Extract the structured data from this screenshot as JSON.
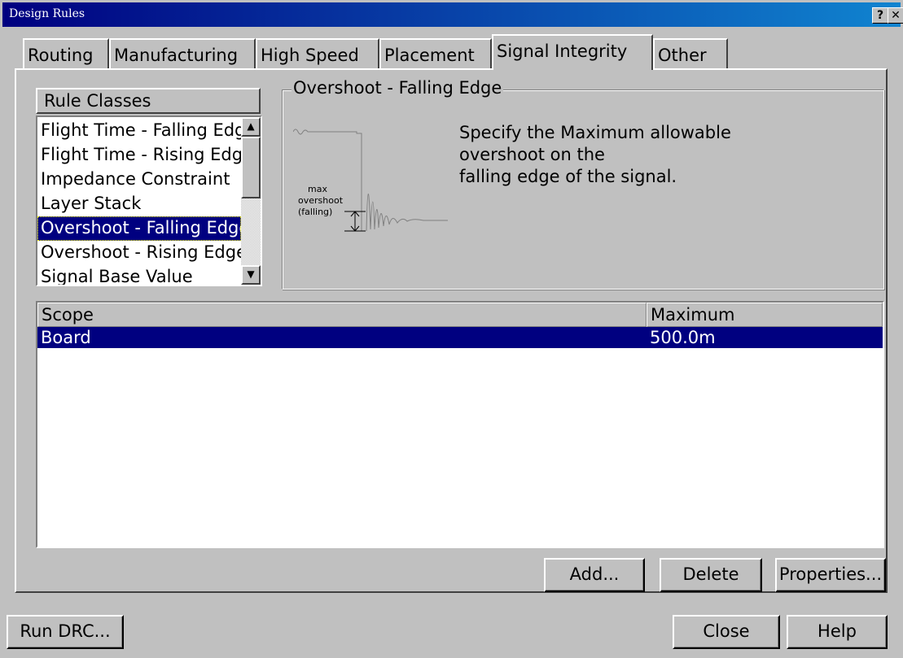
{
  "window": {
    "title": "Design Rules",
    "help_btn": "?",
    "close_btn": "✕"
  },
  "tabs": [
    {
      "label": "Routing"
    },
    {
      "label": "Manufacturing"
    },
    {
      "label": "High Speed"
    },
    {
      "label": "Placement"
    },
    {
      "label": "Signal Integrity",
      "active": true
    },
    {
      "label": "Other"
    }
  ],
  "rule_classes": {
    "header": "Rule Classes",
    "items": [
      "Flight Time - Falling Edge",
      "Flight Time - Rising Edge",
      "Impedance Constraint",
      "Layer Stack",
      "Overshoot - Falling Edge",
      "Overshoot - Rising Edge",
      "Signal Base Value"
    ],
    "selected_index": 4
  },
  "description": {
    "group_title": "Overshoot - Falling Edge",
    "text_line1": "Specify the Maximum allowable",
    "text_line2": "overshoot on the",
    "text_line3": "falling edge of the signal.",
    "diagram_label1": "max",
    "diagram_label2": "overshoot",
    "diagram_label3": "(falling)"
  },
  "table": {
    "col_scope": "Scope",
    "col_max": "Maximum",
    "rows": [
      {
        "scope": "Board",
        "maximum": "500.0m"
      }
    ]
  },
  "buttons": {
    "add": "Add...",
    "delete": "Delete",
    "properties": "Properties...",
    "run_drc": "Run DRC...",
    "close": "Close",
    "help": "Help"
  },
  "colors": {
    "title_bar": "#000080",
    "selection": "#000080",
    "face": "#c0c0c0"
  }
}
